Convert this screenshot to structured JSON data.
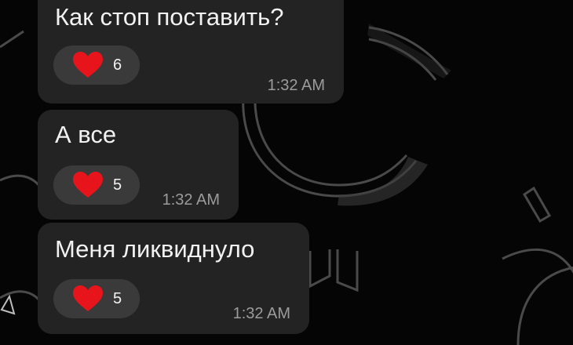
{
  "messages": [
    {
      "text": "Как стоп поставить?",
      "reaction_icon": "heart-icon",
      "reaction_count": "6",
      "time": "1:32 AM"
    },
    {
      "text": "А все",
      "reaction_icon": "heart-icon",
      "reaction_count": "5",
      "time": "1:32 AM"
    },
    {
      "text": "Меня ликвиднуло",
      "reaction_icon": "heart-icon",
      "reaction_count": "5",
      "time": "1:32 AM"
    }
  ],
  "colors": {
    "background": "#050505",
    "bubble": "#232323",
    "reaction_pill": "#3a3a3a",
    "heart": "#e8141b",
    "text": "#f2f2f2",
    "time": "#9b9b9b"
  }
}
